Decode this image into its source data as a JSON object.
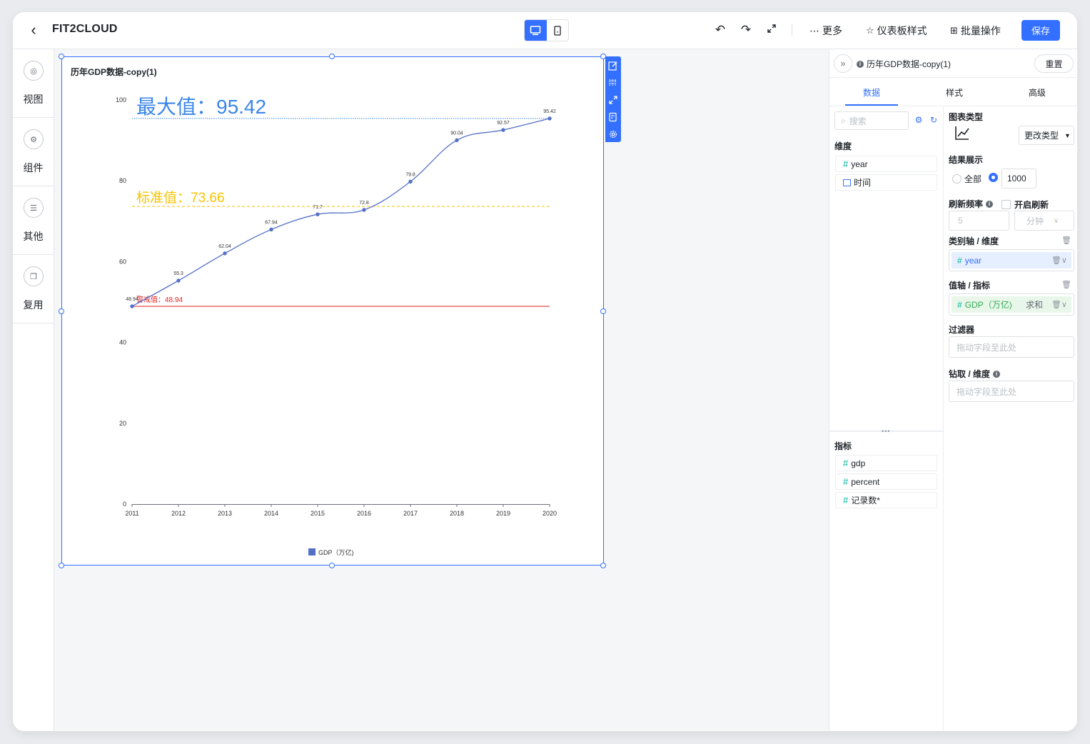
{
  "header": {
    "app_title": "FIT2CLOUD",
    "more_label": "更多",
    "dashboard_style_label": "仪表板样式",
    "batch_label": "批量操作",
    "save_label": "保存"
  },
  "sidebar": {
    "items": [
      {
        "label": "视图",
        "icon": "view-icon"
      },
      {
        "label": "组件",
        "icon": "component-icon"
      },
      {
        "label": "其他",
        "icon": "other-icon"
      },
      {
        "label": "复用",
        "icon": "reuse-icon"
      }
    ]
  },
  "chart_data": {
    "type": "line",
    "title": "历年GDP数据-copy(1)",
    "categories": [
      "2011",
      "2012",
      "2013",
      "2014",
      "2015",
      "2016",
      "2017",
      "2018",
      "2019",
      "2020"
    ],
    "series": [
      {
        "name": "GDP（万亿)",
        "values": [
          48.94,
          55.3,
          62.04,
          67.94,
          71.7,
          72.8,
          79.8,
          90.04,
          92.57,
          95.42
        ],
        "color": "#5470c6"
      }
    ],
    "y_ticks": [
      "0",
      "20",
      "40",
      "60",
      "80",
      "100"
    ],
    "ylim": [
      0,
      100
    ],
    "grid": false,
    "legend": "bottom",
    "smooth": true,
    "lines": [
      {
        "label": "最大值：95.42",
        "value": 95.42,
        "color": "#3a86e8",
        "style": "dotted"
      },
      {
        "label": "标准值：73.66",
        "value": 73.66,
        "color": "#f7c400",
        "style": "dashed"
      },
      {
        "label": "警戒值：48.94",
        "value": 48.94,
        "color": "#e01d1d",
        "style": "solid"
      }
    ]
  },
  "panel": {
    "title": "历年GDP数据-copy(1)",
    "reset_label": "重置",
    "tabs": [
      "数据",
      "样式",
      "高级"
    ],
    "search_placeholder": "搜索",
    "dimension_header": "维度",
    "dimensions": [
      "year",
      "时间"
    ],
    "metric_header": "指标",
    "metrics": [
      "gdp",
      "percent",
      "记录数*"
    ],
    "chart_type_label": "图表类型",
    "change_type_label": "更改类型",
    "result_label": "结果展示",
    "result_all": "全部",
    "result_count": "1000",
    "refresh_label": "刷新频率",
    "refresh_enable": "开启刷新",
    "refresh_value": "5",
    "refresh_unit": "分钟",
    "category_axis_label": "类别轴 / 维度",
    "category_axis_field": "year",
    "value_axis_label": "值轴 / 指标",
    "value_axis_field": "GDP（万亿)",
    "value_axis_agg": "求和",
    "filter_label": "过滤器",
    "filter_placeholder": "拖动字段至此处",
    "drill_label": "钻取 / 维度",
    "drill_placeholder": "拖动字段至此处"
  }
}
